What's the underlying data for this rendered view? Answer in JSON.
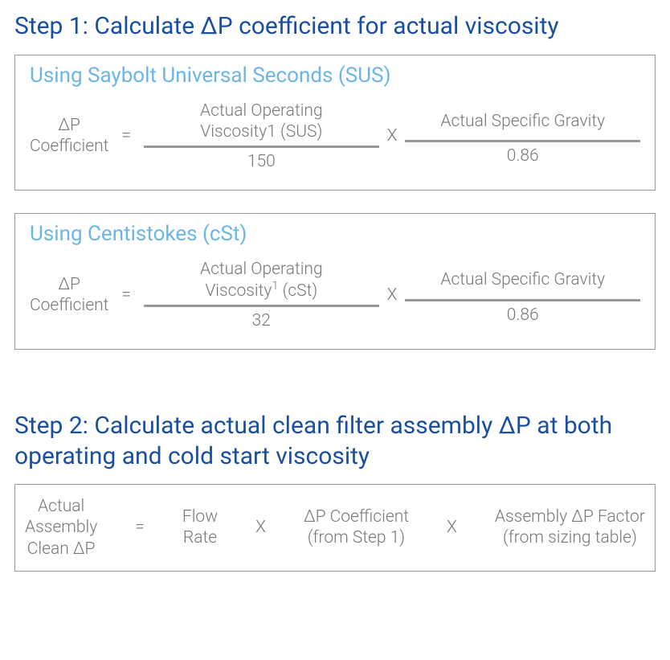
{
  "step1": {
    "heading": "Step 1: Calculate ΔP coefficient for actual viscosity",
    "sus": {
      "title": "Using Saybolt Universal Seconds (SUS)",
      "lhs_line1": "ΔP",
      "lhs_line2": "Coefficient",
      "eq": "=",
      "frac1_num_line1": "Actual Operating",
      "frac1_num_line2": "Viscosity1 (SUS)",
      "frac1_den": "150",
      "times": "X",
      "frac2_num": "Actual Specific Gravity",
      "frac2_den": "0.86"
    },
    "cst": {
      "title": "Using Centistokes (cSt)",
      "lhs_line1": "ΔP",
      "lhs_line2": "Coefficient",
      "eq": "=",
      "frac1_num_line1": "Actual Operating",
      "frac1_num_line2_pre": "Viscosity",
      "frac1_num_line2_sup": "1",
      "frac1_num_line2_post": " (cSt)",
      "frac1_den": "32",
      "times": "X",
      "frac2_num": "Actual Specific Gravity",
      "frac2_den": "0.86"
    }
  },
  "step2": {
    "heading": "Step 2: Calculate actual clean filter assembly ΔP at both operating and cold start viscosity",
    "lhs_line1": "Actual",
    "lhs_line2": "Assembly",
    "lhs_line3": "Clean ΔP",
    "eq": "=",
    "term1_line1": "Flow",
    "term1_line2": "Rate",
    "times1": "X",
    "term2_line1": "ΔP Coefficient",
    "term2_line2": "(from Step 1)",
    "times2": "X",
    "term3_line1": "Assembly ΔP Factor",
    "term3_line2": "(from sizing table)"
  }
}
